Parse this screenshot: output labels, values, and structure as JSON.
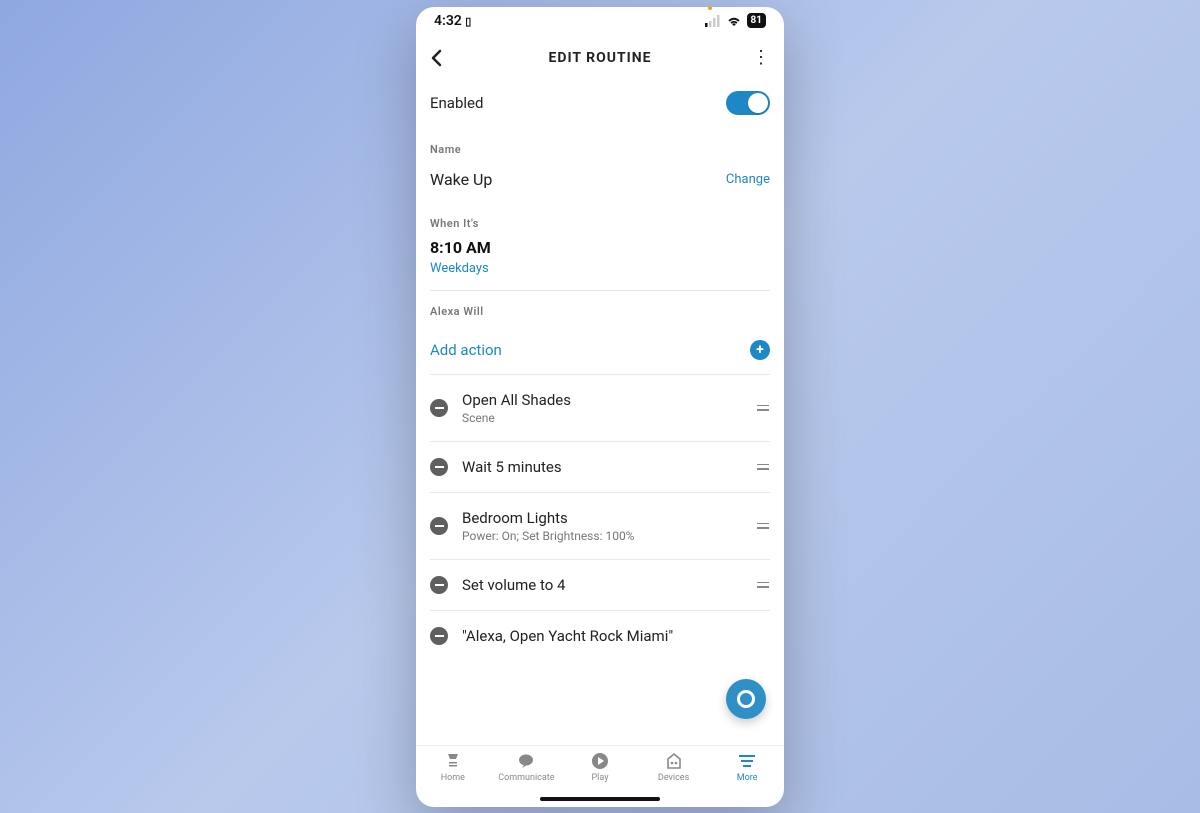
{
  "statusbar": {
    "time": "4:32",
    "battery": "81"
  },
  "header": {
    "title": "EDIT ROUTINE"
  },
  "enabled": {
    "label": "Enabled",
    "value": true
  },
  "name": {
    "section_label": "Name",
    "value": "Wake Up",
    "change_link": "Change"
  },
  "schedule": {
    "section_label": "When It's",
    "time": "8:10 AM",
    "repeat": "Weekdays"
  },
  "actions": {
    "section_label": "Alexa Will",
    "add_label": "Add action",
    "items": [
      {
        "title": "Open All Shades",
        "subtitle": "Scene"
      },
      {
        "title": "Wait 5 minutes",
        "subtitle": ""
      },
      {
        "title": "Bedroom Lights",
        "subtitle": "Power: On; Set Brightness: 100%"
      },
      {
        "title": "Set volume to 4",
        "subtitle": ""
      },
      {
        "title": "\"Alexa, Open Yacht Rock Miami\"",
        "subtitle": ""
      }
    ]
  },
  "tabs": {
    "items": [
      {
        "label": "Home"
      },
      {
        "label": "Communicate"
      },
      {
        "label": "Play"
      },
      {
        "label": "Devices"
      },
      {
        "label": "More"
      }
    ],
    "active_index": 4
  }
}
